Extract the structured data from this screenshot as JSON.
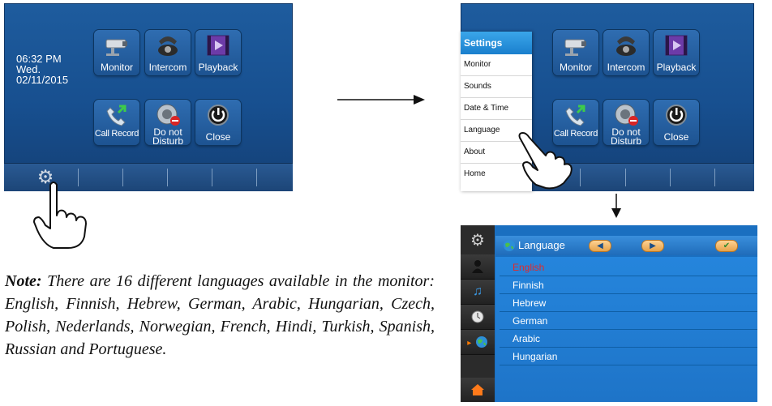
{
  "screen1": {
    "time": "06:32 PM",
    "day": "Wed.",
    "date": "02/11/2015",
    "tiles": [
      {
        "label": "Monitor",
        "icon": "camera-icon"
      },
      {
        "label": "Intercom",
        "icon": "phone-icon"
      },
      {
        "label": "Playback",
        "icon": "film-icon"
      },
      {
        "label": "Call Record",
        "icon": "call-record-icon"
      },
      {
        "label1": "Do not",
        "label2": "Disturb",
        "icon": "do-not-disturb-icon"
      },
      {
        "label": "Close",
        "icon": "power-icon"
      }
    ],
    "taskbar_icon": "gear-icon"
  },
  "screen2": {
    "menu_title": "Settings",
    "menu_items": [
      "Monitor",
      "Sounds",
      "Date & Time",
      "Language",
      "About",
      "Home"
    ],
    "tiles": [
      {
        "label": "Monitor"
      },
      {
        "label": "Intercom"
      },
      {
        "label": "Playback"
      },
      {
        "label": "Call Record"
      },
      {
        "label1": "Do not",
        "label2": "Disturb"
      },
      {
        "label": "Close"
      }
    ]
  },
  "screen3": {
    "header_title": "Language",
    "buttons": [
      "left-arrow-icon",
      "right-arrow-icon",
      "check-icon"
    ],
    "side_icons": [
      "gear-icon",
      "person-icon",
      "music-note-icon",
      "clock-icon",
      "globe-icon",
      "home-icon"
    ],
    "languages": [
      "English",
      "Finnish",
      "Hebrew",
      "German",
      "Arabic",
      "Hungarian"
    ],
    "selected_language": "English",
    "selected_color": "#e02a2a"
  },
  "note": {
    "label": "Note:",
    "text": " There are 16 different languages available in the monitor: English, Finnish, Hebrew, German, Arabic, Hungarian, Czech, Polish, Nederlands, Norwegian, French, Hindi, Turkish, Spanish, Russian and Portuguese."
  },
  "colors": {
    "screen_blue": "#1e5c9e",
    "tile_blue": "#2f6db1",
    "menu_header": "#1a7fcd",
    "pill_orange": "#e6a24a"
  }
}
